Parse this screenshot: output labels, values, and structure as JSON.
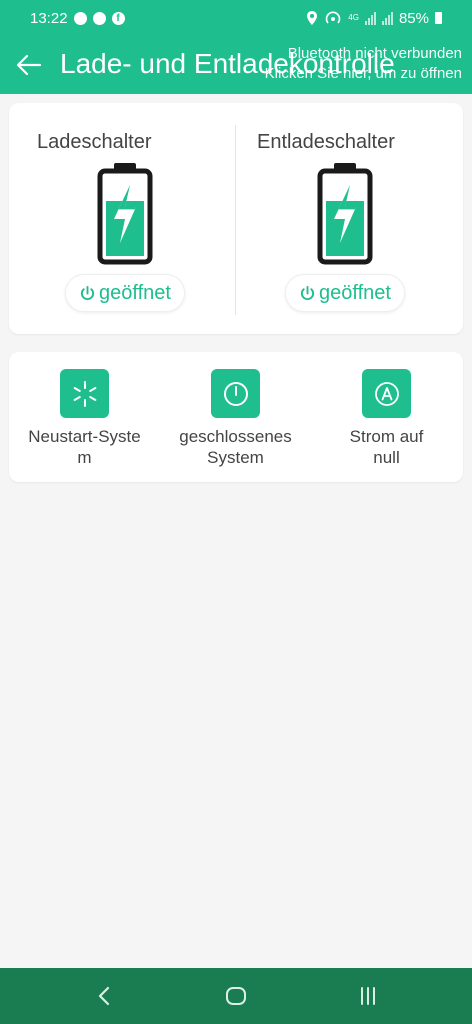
{
  "colors": {
    "accent": "#1ebe8e",
    "nav_bar": "#1a7d52",
    "background": "#f5f5f5"
  },
  "status_bar": {
    "time": "13:22",
    "notification_icons": [
      "messenger-icon",
      "messenger-icon",
      "facebook-icon"
    ],
    "status_icons": [
      "location-icon",
      "hotspot-icon",
      "4g-icon",
      "signal-icon",
      "signal-icon"
    ],
    "battery": "85%"
  },
  "header": {
    "title": "Lade- und Entladekontrolle",
    "bt_status_line1": "Bluetooth nicht verbunden",
    "bt_status_line2": "Klicken Sie hier, um zu öffnen"
  },
  "switches": {
    "charge": {
      "label": "Ladeschalter",
      "state": "geöffnet"
    },
    "discharge": {
      "label": "Entladeschalter",
      "state": "geöffnet"
    }
  },
  "actions": [
    {
      "label": "Neustart-Syste\nm",
      "icon": "restart-icon"
    },
    {
      "label": "geschlossenes\nSystem",
      "icon": "power-icon"
    },
    {
      "label": "Strom auf\nnull",
      "icon": "current-zero-icon"
    }
  ],
  "nav": [
    "back",
    "home",
    "recents"
  ]
}
